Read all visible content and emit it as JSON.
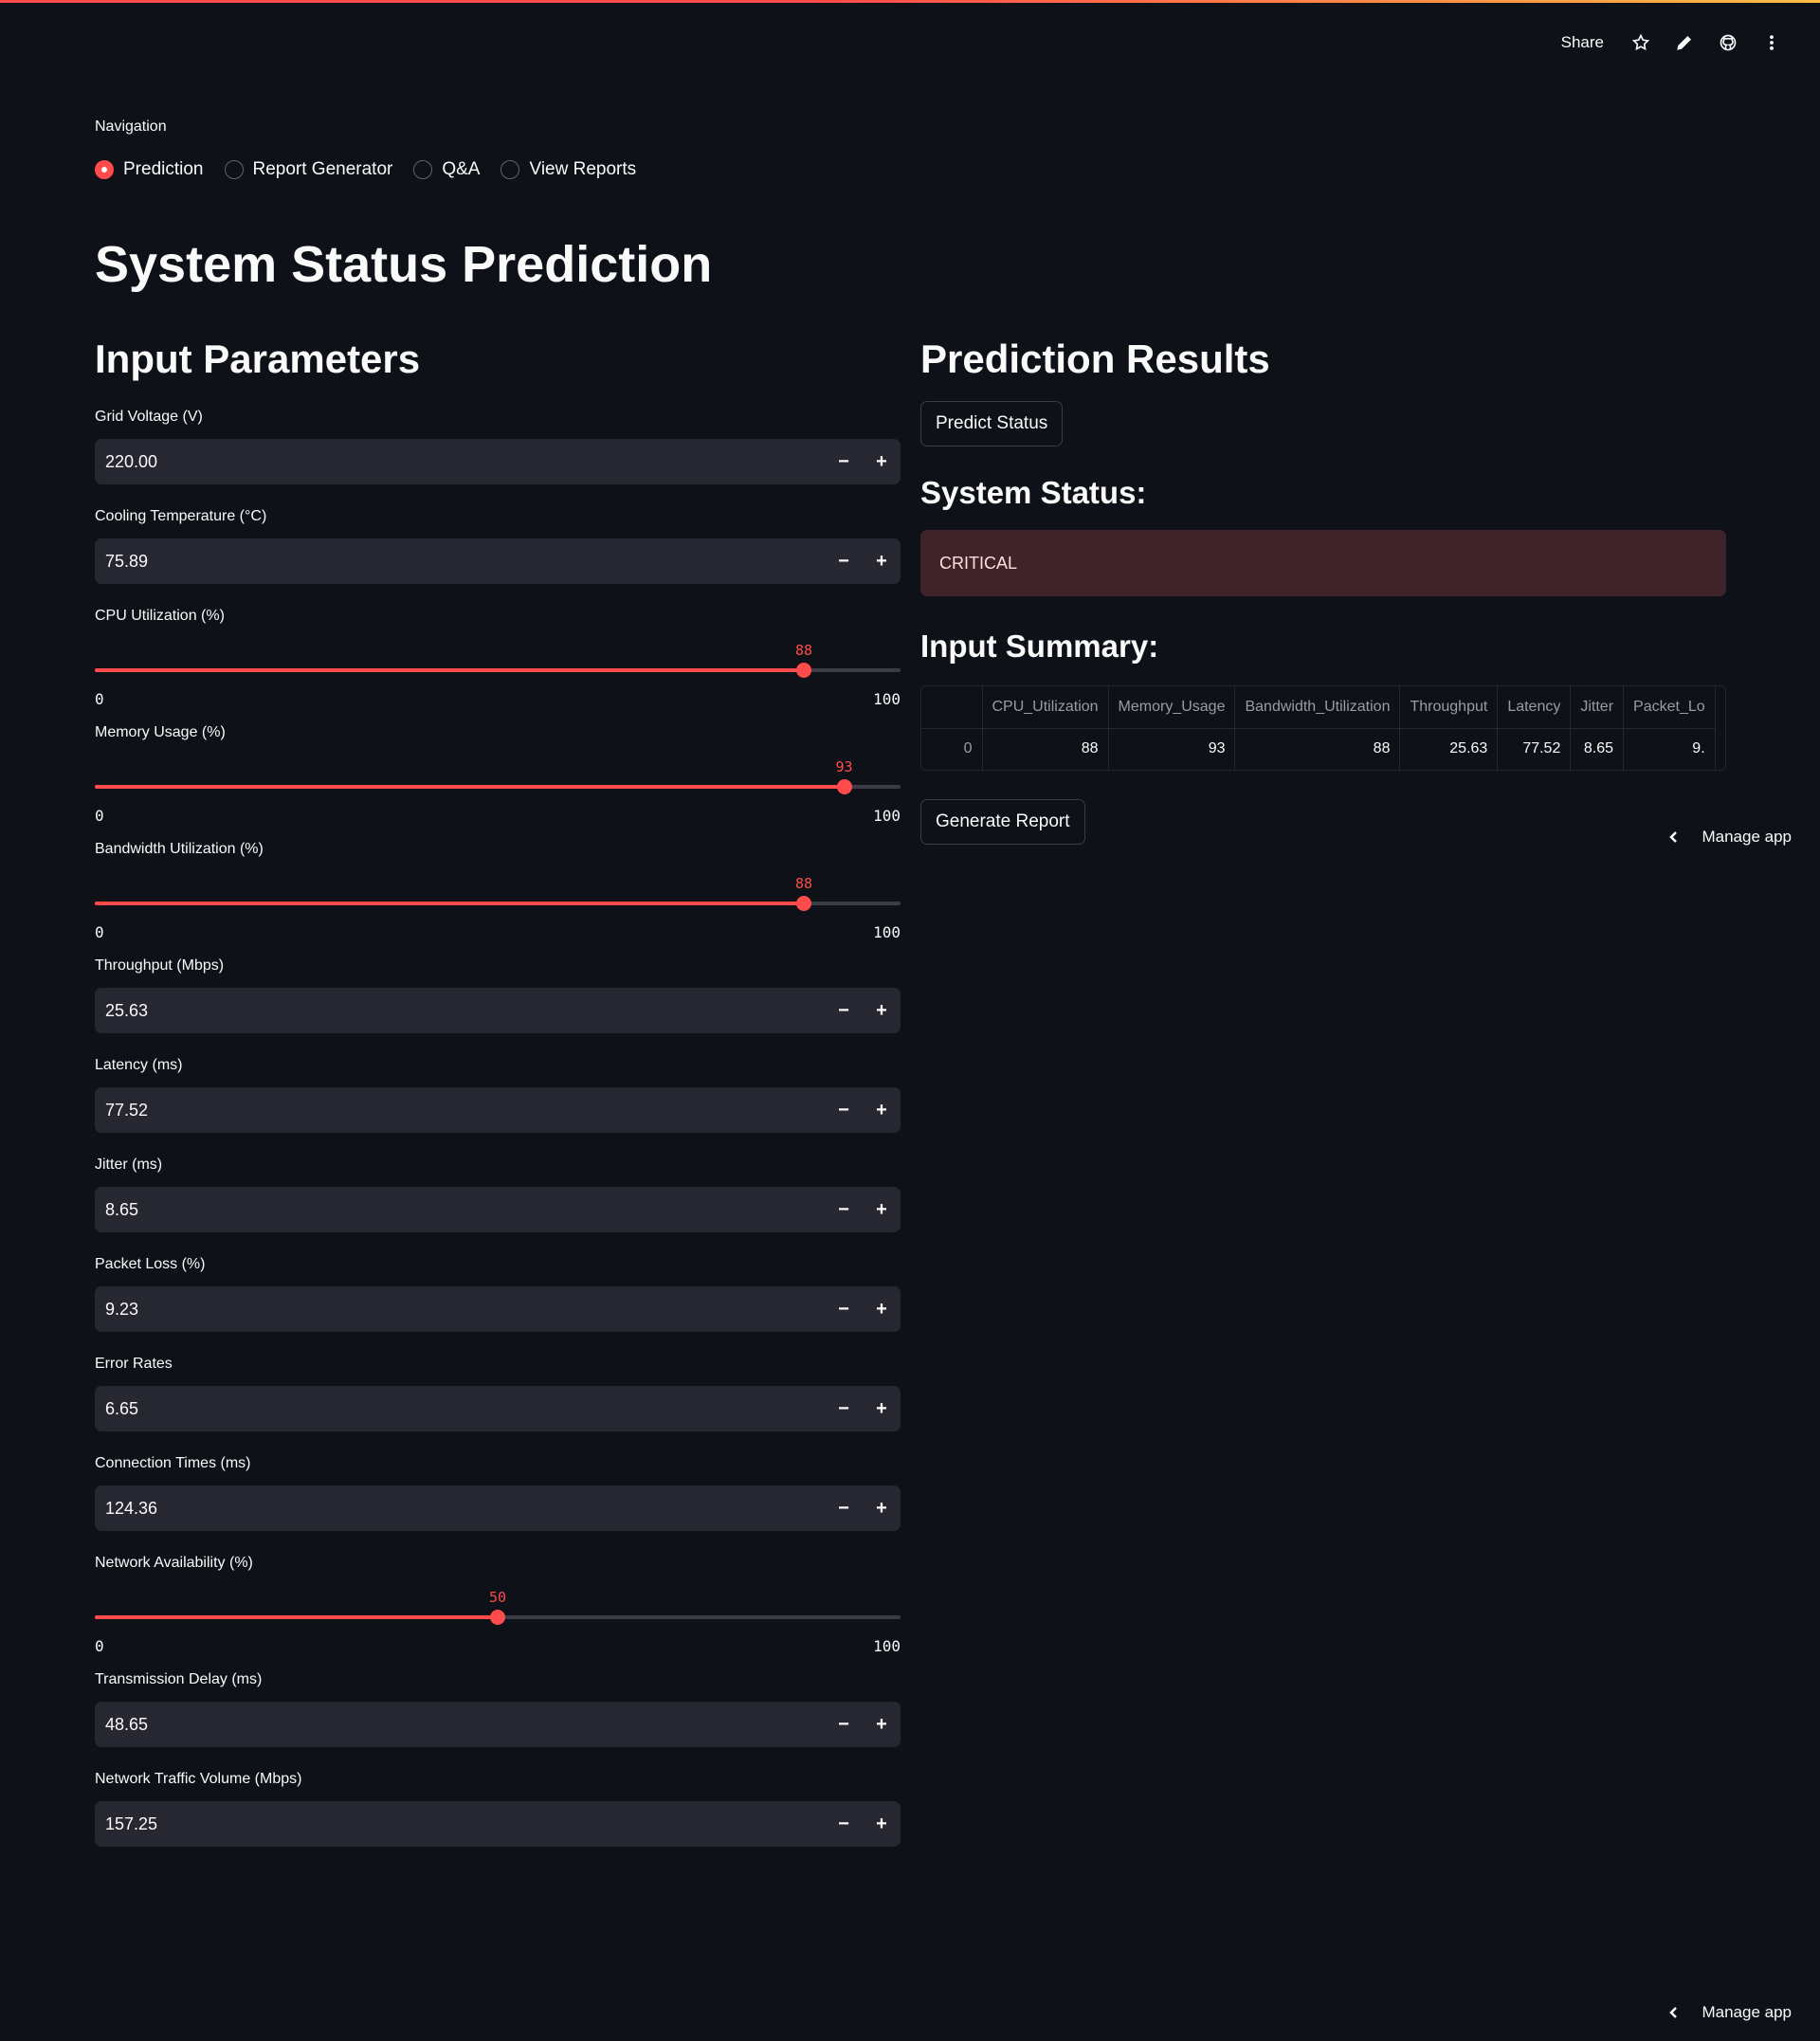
{
  "header": {
    "share_label": "Share",
    "icons": [
      "star-icon",
      "pencil-icon",
      "github-icon",
      "more-vertical-icon"
    ]
  },
  "navigation": {
    "label": "Navigation",
    "options": [
      {
        "label": "Prediction",
        "selected": true
      },
      {
        "label": "Report Generator",
        "selected": false
      },
      {
        "label": "Q&A",
        "selected": false
      },
      {
        "label": "View Reports",
        "selected": false
      }
    ]
  },
  "page_title": "System Status Prediction",
  "inputs": {
    "heading": "Input Parameters",
    "grid_voltage": {
      "label": "Grid Voltage (V)",
      "value": "220.00"
    },
    "cooling_temperature": {
      "label": "Cooling Temperature (°C)",
      "value": "75.89"
    },
    "cpu_utilization": {
      "label": "CPU Utilization (%)",
      "value": 88,
      "min": "0",
      "max": "100"
    },
    "memory_usage": {
      "label": "Memory Usage (%)",
      "value": 93,
      "min": "0",
      "max": "100"
    },
    "bandwidth_utilization": {
      "label": "Bandwidth Utilization (%)",
      "value": 88,
      "min": "0",
      "max": "100"
    },
    "throughput": {
      "label": "Throughput (Mbps)",
      "value": "25.63"
    },
    "latency": {
      "label": "Latency (ms)",
      "value": "77.52"
    },
    "jitter": {
      "label": "Jitter (ms)",
      "value": "8.65"
    },
    "packet_loss": {
      "label": "Packet Loss (%)",
      "value": "9.23"
    },
    "error_rates": {
      "label": "Error Rates",
      "value": "6.65"
    },
    "connection_times": {
      "label": "Connection Times (ms)",
      "value": "124.36"
    },
    "network_availability": {
      "label": "Network Availability (%)",
      "value": 50,
      "min": "0",
      "max": "100"
    },
    "transmission_delay": {
      "label": "Transmission Delay (ms)",
      "value": "48.65"
    },
    "network_traffic_volume": {
      "label": "Network Traffic Volume (Mbps)",
      "value": "157.25"
    },
    "stepper": {
      "minus": "−",
      "plus": "+"
    }
  },
  "results": {
    "heading": "Prediction Results",
    "predict_button": "Predict Status",
    "status_heading": "System Status:",
    "status_value": "CRITICAL",
    "summary_heading": "Input Summary:",
    "table": {
      "columns": [
        "",
        "CPU_Utilization",
        "Memory_Usage",
        "Bandwidth_Utilization",
        "Throughput",
        "Latency",
        "Jitter",
        "Packet_Lo"
      ],
      "row": [
        "0",
        "88",
        "93",
        "88",
        "25.63",
        "77.52",
        "8.65",
        "9."
      ]
    },
    "generate_button": "Generate Report"
  },
  "manage_app_label": "Manage app",
  "colors": {
    "background": "#0e1117",
    "accent": "#ff4b4b",
    "input_bg": "#262730",
    "error_bg": "#3e2428"
  }
}
